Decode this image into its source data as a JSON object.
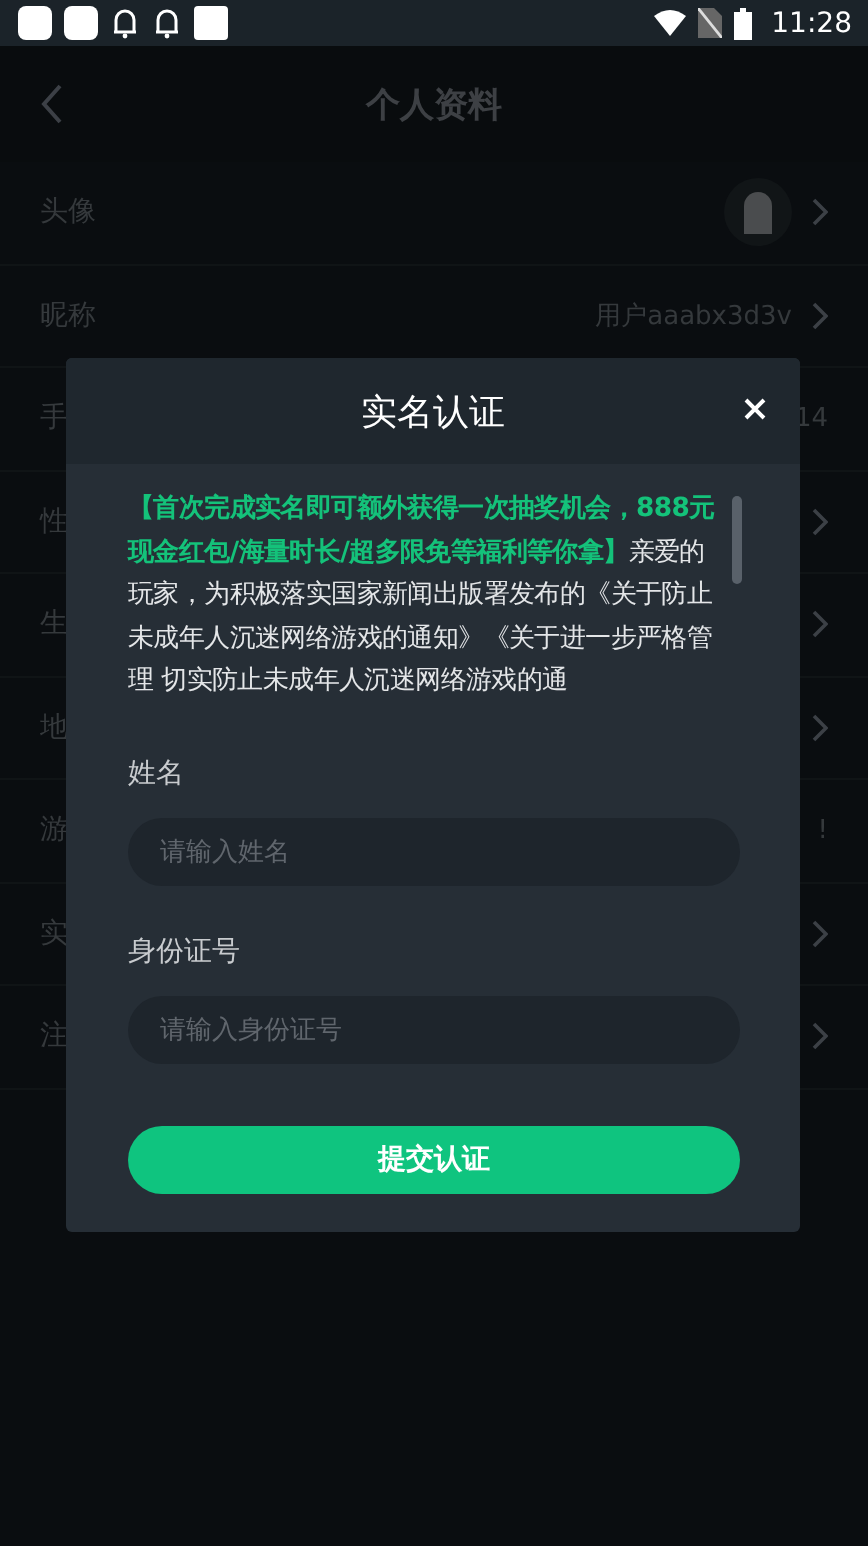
{
  "status_bar": {
    "time": "11:28"
  },
  "header": {
    "title": "个人资料"
  },
  "rows": [
    {
      "label": "头像",
      "kind": "avatar",
      "chevron": true
    },
    {
      "label": "昵称",
      "kind": "value",
      "value": "用户aaabx3d3v",
      "chevron": true
    },
    {
      "label": "手",
      "kind": "value",
      "value": "14",
      "chevron": false
    },
    {
      "label": "性",
      "kind": "plain",
      "chevron": true
    },
    {
      "label": "生",
      "kind": "plain",
      "chevron": true
    },
    {
      "label": "地",
      "kind": "plain",
      "chevron": true
    },
    {
      "label": "游",
      "kind": "value",
      "value": "!",
      "chevron": false
    },
    {
      "label": "实",
      "kind": "plain",
      "chevron": true
    },
    {
      "label": "注",
      "kind": "plain",
      "chevron": true
    }
  ],
  "dialog": {
    "title": "实名认证",
    "notice": "**【首次完成实名即可额外获得一次抽奖机会，888元现金红包/海量时长/超多限免等福利等你拿】**亲爱的玩家，为积极落实国家新闻出版署发布的《关于防止未成年人沉迷网络游戏的通知》《关于进一步严格管理 切实防止未成年人沉迷网络游戏的通",
    "fields": [
      {
        "label": "姓名",
        "placeholder": "请输入姓名"
      },
      {
        "label": "身份证号",
        "placeholder": "请输入身份证号"
      }
    ],
    "submit": "提交认证"
  }
}
